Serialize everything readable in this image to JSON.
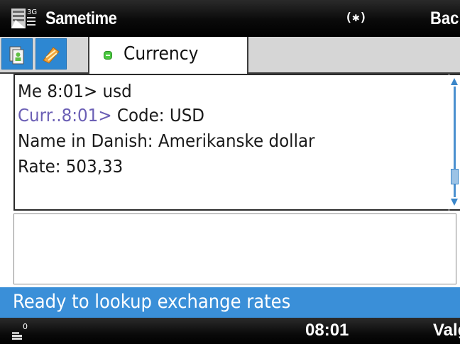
{
  "title_bar": {
    "app_title": "Sametime",
    "bluetooth_indicator": "(✱)",
    "right_softkey": "Bac",
    "app_icon": "sametime-app-icon"
  },
  "tabs": {
    "icon_tab_1": "contacts-icon",
    "icon_tab_2": "status-icon",
    "active_tab": {
      "label": "Currency",
      "presence_color": "#49c83f"
    }
  },
  "chat": {
    "messages": [
      {
        "sender": "Me",
        "time": "8:01>",
        "text": "usd"
      },
      {
        "sender": "Curr..",
        "time": "8:01>",
        "text": "Code: USD"
      },
      {
        "text": "Name in Danish: Amerikanske dollar"
      },
      {
        "text": "Rate: 503,33"
      }
    ]
  },
  "status": {
    "text": "Ready to lookup exchange rates"
  },
  "bottom_bar": {
    "signal_level": "0",
    "time": "08:01",
    "left_softkey": "Valg"
  },
  "colors": {
    "accent": "#3a8fd8",
    "sender_color": "#6b5fb5"
  }
}
